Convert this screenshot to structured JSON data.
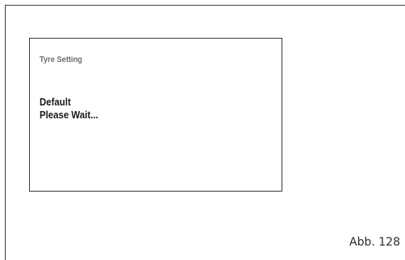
{
  "screen": {
    "title": "Tyre Setting",
    "lines": [
      "Default",
      "Please Wait..."
    ]
  },
  "caption": "Abb. 128"
}
